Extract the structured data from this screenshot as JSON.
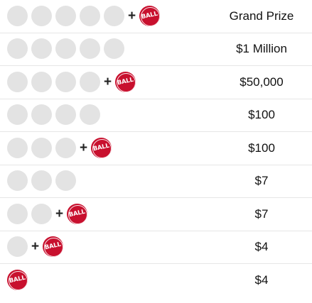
{
  "bonus_ball": {
    "label": "BALL",
    "color": "#c8102e"
  },
  "plus_symbol": "+",
  "rows": [
    {
      "white_balls": 5,
      "bonus": true,
      "prize": "Grand Prize"
    },
    {
      "white_balls": 5,
      "bonus": false,
      "prize": "$1 Million"
    },
    {
      "white_balls": 4,
      "bonus": true,
      "prize": "$50,000"
    },
    {
      "white_balls": 4,
      "bonus": false,
      "prize": "$100"
    },
    {
      "white_balls": 3,
      "bonus": true,
      "prize": "$100"
    },
    {
      "white_balls": 3,
      "bonus": false,
      "prize": "$7"
    },
    {
      "white_balls": 2,
      "bonus": true,
      "prize": "$7"
    },
    {
      "white_balls": 1,
      "bonus": true,
      "prize": "$4"
    },
    {
      "white_balls": 0,
      "bonus": true,
      "prize": "$4"
    }
  ]
}
